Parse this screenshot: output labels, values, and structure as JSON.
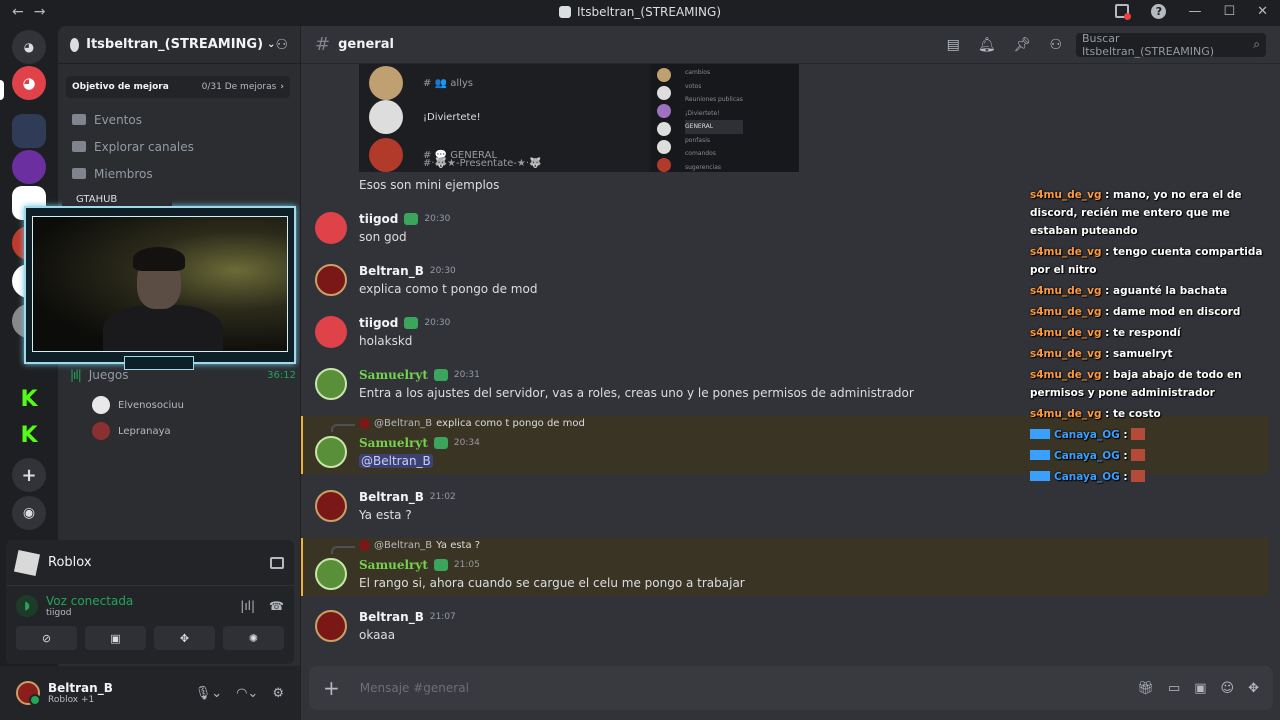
{
  "titlebar": {
    "title": "Itsbeltran_(STREAMING)",
    "back": "←",
    "forward": "→",
    "minimize": "—",
    "maximize": "☐",
    "close": "✕",
    "help": "?"
  },
  "rail": {
    "colors": [
      "#5865f2",
      "#e0424a",
      "#2f3b57",
      "#6b2fa0",
      "#ffffff",
      "#c0392b",
      "#ffffff",
      "#888888",
      "#53fc18",
      "#53fc18"
    ],
    "add": "+",
    "explore": "◉"
  },
  "sidebar": {
    "server_name": "Itsbeltran_(STREAMING)",
    "boost_label": "Objetivo de mejora",
    "boost_count": "0/31 De mejoras",
    "items": [
      {
        "label": "Eventos"
      },
      {
        "label": "Explorar canales"
      },
      {
        "label": "Miembros"
      }
    ],
    "overlay_tag": "GTAHUB",
    "voice_channel": "Juegos",
    "voice_timer": "36:12",
    "voice_users": [
      "Elvenosociuu",
      "Lepranaya"
    ]
  },
  "activity": {
    "game": "Roblox",
    "voice_status": "Voz conectada",
    "voice_channel": "tiigod"
  },
  "user": {
    "name": "Beltran_B",
    "status": "Roblox +1"
  },
  "channel": {
    "name": "general",
    "search_placeholder": "Buscar Itsbeltran_(STREAMING)",
    "composer_placeholder": "Mensaje #general"
  },
  "embed": {
    "rows": [
      "# 👥 allys",
      "¡Diviertete!",
      "# 💬 GENERAL",
      "#·🐺★-Presentate-★·🐺"
    ],
    "right_rows": [
      "cambios",
      "votos",
      "Reuniones publicas",
      "¡Diviertete!",
      "GENERAL",
      "ponfasis",
      "comandos",
      "sugerencias"
    ]
  },
  "messages": [
    {
      "text": "Esos son mini ejemplos"
    },
    {
      "author": "tiigod",
      "time": "20:30",
      "text": "son god"
    },
    {
      "author": "Beltran_B",
      "time": "20:30",
      "text": "explica como t pongo de mod"
    },
    {
      "author": "tiigod",
      "time": "20:30",
      "text": "holakskd"
    },
    {
      "author": "Samuelryt",
      "time": "20:31",
      "text": "Entra a los ajustes del servidor, vas a roles, creas uno y le pones permisos de administrador"
    },
    {
      "reply_to": "@Beltran_B",
      "reply_text": "explica como t pongo de mod",
      "author": "Samuelryt",
      "time": "20:34",
      "text": "@Beltran_B"
    },
    {
      "author": "Beltran_B",
      "time": "21:02",
      "text": "Ya esta ?"
    },
    {
      "reply_to": "@Beltran_B",
      "reply_text": "Ya esta ?",
      "author": "Samuelryt",
      "time": "21:05",
      "text": "El rango si, ahora cuando se cargue el celu me pongo a trabajar"
    },
    {
      "author": "Beltran_B",
      "time": "21:07",
      "text": "okaaa"
    }
  ],
  "stream_chat": [
    {
      "user": "s4mu_de_vg",
      "text": " : mano, yo no era el de discord, recién me entero que me estaban puteando"
    },
    {
      "user": "s4mu_de_vg",
      "text": " : tengo cuenta compartida por el nitro"
    },
    {
      "user": "s4mu_de_vg",
      "text": " : aguanté la bachata"
    },
    {
      "user": "s4mu_de_vg",
      "text": " : dame mod en discord"
    },
    {
      "user": "s4mu_de_vg",
      "text": " : te respondí"
    },
    {
      "user": "s4mu_de_vg",
      "text": " : samuelryt"
    },
    {
      "user": "s4mu_de_vg",
      "text": " : baja abajo de todo en permisos y pone administrador"
    },
    {
      "user": "s4mu_de_vg",
      "text": " : te costo"
    },
    {
      "user": "Canaya_OG",
      "text": " : "
    },
    {
      "user": "Canaya_OG",
      "text": " : "
    },
    {
      "user": "Canaya_OG",
      "text": " : "
    }
  ]
}
